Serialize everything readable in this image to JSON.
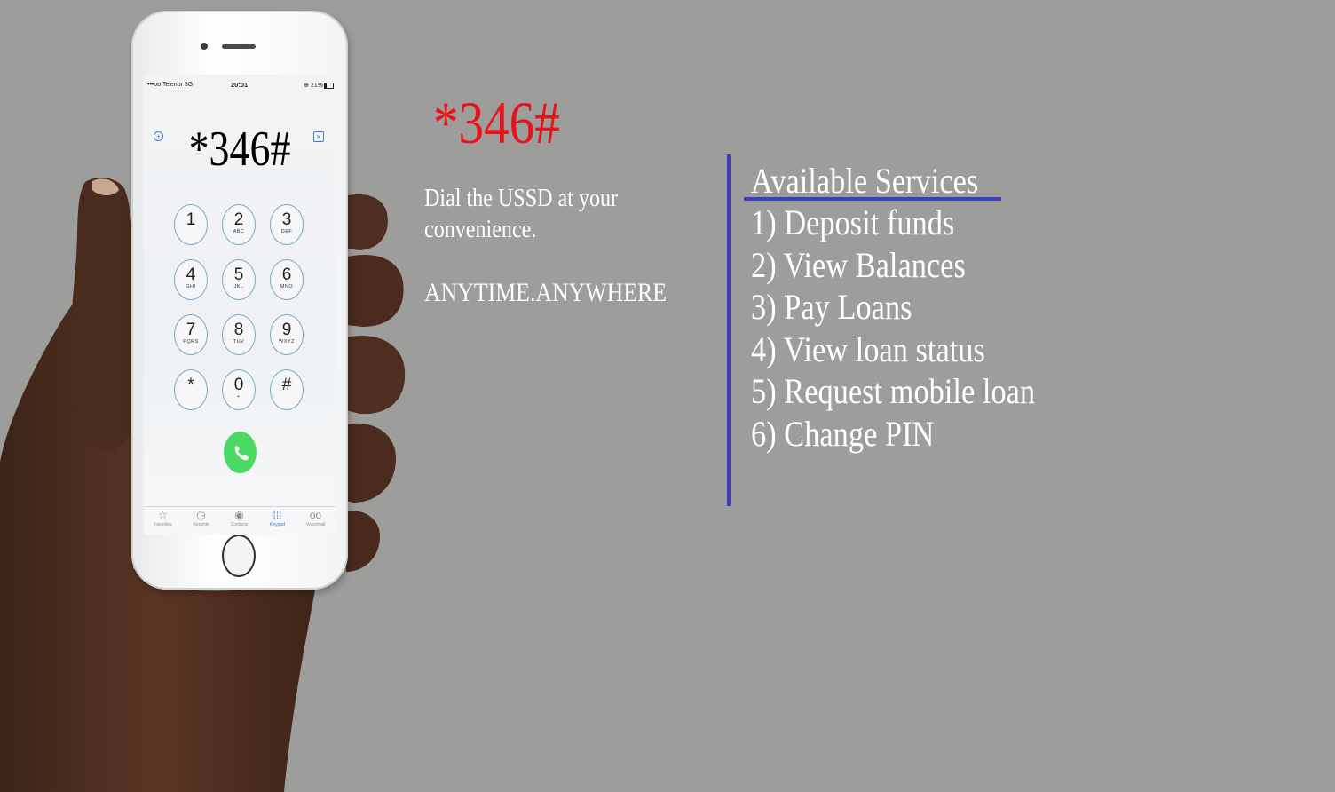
{
  "phone": {
    "status": {
      "carrier": "•••oo Telenor  3G",
      "time": "20:01",
      "battery": "⊕ 21%"
    },
    "dialed_number": "*346#",
    "keys": [
      {
        "digit": "1",
        "letters": ""
      },
      {
        "digit": "2",
        "letters": "ABC"
      },
      {
        "digit": "3",
        "letters": "DEF"
      },
      {
        "digit": "4",
        "letters": "GHI"
      },
      {
        "digit": "5",
        "letters": "JKL"
      },
      {
        "digit": "6",
        "letters": "MNO"
      },
      {
        "digit": "7",
        "letters": "PQRS"
      },
      {
        "digit": "8",
        "letters": "TUV"
      },
      {
        "digit": "9",
        "letters": "WXYZ"
      },
      {
        "digit": "*",
        "letters": ""
      },
      {
        "digit": "0",
        "letters": "+"
      },
      {
        "digit": "#",
        "letters": ""
      }
    ],
    "tabs": [
      {
        "icon": "☆",
        "label": "Favorites"
      },
      {
        "icon": "◷",
        "label": "Recents"
      },
      {
        "icon": "◉",
        "label": "Contacts"
      },
      {
        "icon": "⁞⁞⁞",
        "label": "Keypad"
      },
      {
        "icon": "oo",
        "label": "Voicemail"
      }
    ],
    "active_tab": "Keypad",
    "call_color": "#4cd964"
  },
  "hero": {
    "code": "*346#",
    "code_color": "#e8121b",
    "tagline": "Dial the USSD at your convenience.",
    "slogan": "ANYTIME.ANYWHERE"
  },
  "services": {
    "title": "Available Services",
    "accent": "#3b3dc0",
    "items": [
      "1) Deposit funds",
      "2) View Balances",
      "3) Pay Loans",
      "4) View loan status",
      "5) Request mobile loan",
      "6) Change PIN"
    ]
  }
}
